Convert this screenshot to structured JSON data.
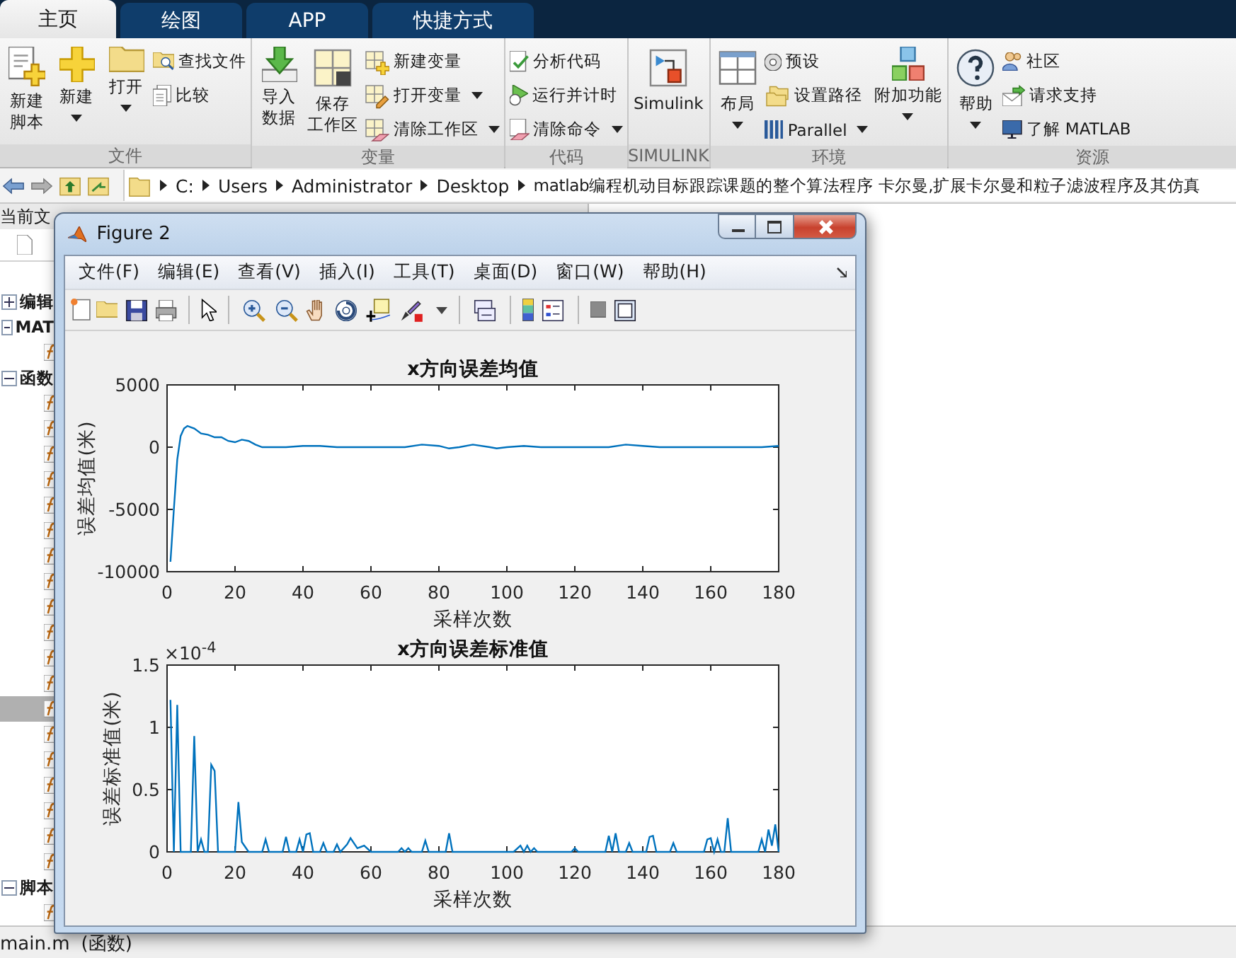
{
  "tabs": [
    {
      "label": "主页",
      "selected": true
    },
    {
      "label": "绘图",
      "selected": false
    },
    {
      "label": "APP",
      "selected": false
    },
    {
      "label": "快捷方式",
      "selected": false
    }
  ],
  "ribbon": [
    {
      "label": "文件",
      "items": [
        {
          "kind": "large",
          "lines": [
            "新建",
            "脚本"
          ],
          "dropdown": false
        },
        {
          "kind": "large",
          "lines": [
            "新建"
          ],
          "dropdown": true
        },
        {
          "kind": "large",
          "lines": [
            "打开"
          ],
          "dropdown": true
        },
        {
          "kind": "column",
          "items": [
            {
              "label": "查找文件",
              "dropdown": false
            },
            {
              "label": "比较",
              "dropdown": false
            }
          ]
        }
      ]
    },
    {
      "label": "变量",
      "items": [
        {
          "kind": "large",
          "lines": [
            "导入",
            "数据"
          ],
          "dropdown": false
        },
        {
          "kind": "large",
          "lines": [
            "保存",
            "工作区"
          ],
          "dropdown": false
        },
        {
          "kind": "column",
          "items": [
            {
              "label": "新建变量",
              "dropdown": false
            },
            {
              "label": "打开变量",
              "dropdown": true
            },
            {
              "label": "清除工作区",
              "dropdown": true
            }
          ]
        }
      ]
    },
    {
      "label": "代码",
      "items": [
        {
          "kind": "column",
          "items": [
            {
              "label": "分析代码",
              "dropdown": false
            },
            {
              "label": "运行并计时",
              "dropdown": false
            },
            {
              "label": "清除命令",
              "dropdown": true
            }
          ]
        }
      ]
    },
    {
      "label": "SIMULINK",
      "items": [
        {
          "kind": "large",
          "lines": [
            "Simulink"
          ],
          "dropdown": false
        }
      ]
    },
    {
      "label": "环境",
      "items": [
        {
          "kind": "large",
          "lines": [
            "布局"
          ],
          "dropdown": true
        },
        {
          "kind": "column",
          "items": [
            {
              "label": "预设",
              "dropdown": false
            },
            {
              "label": "设置路径",
              "dropdown": false
            },
            {
              "label": "Parallel",
              "dropdown": true
            }
          ]
        },
        {
          "kind": "large",
          "lines": [
            "附加功能"
          ],
          "dropdown": true
        }
      ]
    },
    {
      "label": "资源",
      "items": [
        {
          "kind": "large",
          "lines": [
            "帮助"
          ],
          "dropdown": true
        },
        {
          "kind": "column",
          "items": [
            {
              "label": "社区",
              "dropdown": false
            },
            {
              "label": "请求支持",
              "dropdown": false
            },
            {
              "label": "了解 MATLAB",
              "dropdown": false
            }
          ]
        }
      ]
    }
  ],
  "address": {
    "segments": [
      "C:",
      "Users",
      "Administrator",
      "Desktop",
      "matlab编程机动目标跟踪课题的整个算法程序 卡尔曼,扩展卡尔曼和粒子滤波程序及其仿真"
    ]
  },
  "left_panel": {
    "title": "当前文",
    "tree": [
      {
        "label": "编辑",
        "expanded": false
      },
      {
        "label": "MAT",
        "expanded": true,
        "children": [
          {
            "selected": false
          }
        ]
      },
      {
        "label": "函数",
        "expanded": true,
        "children": [
          {
            "selected": false
          },
          {
            "selected": false
          },
          {
            "selected": false
          },
          {
            "selected": false
          },
          {
            "selected": false
          },
          {
            "selected": false
          },
          {
            "selected": false
          },
          {
            "selected": false
          },
          {
            "selected": false
          },
          {
            "selected": false
          },
          {
            "selected": false
          },
          {
            "selected": false
          },
          {
            "selected": true
          },
          {
            "selected": false
          },
          {
            "selected": false
          },
          {
            "selected": false
          },
          {
            "selected": false
          },
          {
            "selected": false
          },
          {
            "selected": false
          }
        ]
      },
      {
        "label": "脚本",
        "expanded": true,
        "children": [
          {
            "selected": false
          }
        ]
      }
    ]
  },
  "status_bar": [
    "main.m",
    "(函数)"
  ],
  "figure": {
    "title": "Figure 2",
    "menu": [
      "文件(F)",
      "编辑(E)",
      "查看(V)",
      "插入(I)",
      "工具(T)",
      "桌面(D)",
      "窗口(W)",
      "帮助(H)"
    ],
    "charts": [
      {
        "chart_data": {
          "type": "line",
          "title": "x方向误差均值",
          "xlabel": "采样次数",
          "ylabel": "误差均值(米)",
          "xlim": [
            0,
            180
          ],
          "ylim": [
            -10000,
            5000
          ],
          "xticks": [
            0,
            20,
            40,
            60,
            80,
            100,
            120,
            140,
            160,
            180
          ],
          "yticks": [
            -10000,
            -5000,
            0,
            5000
          ],
          "x": [
            1,
            2,
            3,
            4,
            5,
            6,
            7,
            8,
            10,
            12,
            14,
            16,
            18,
            20,
            22,
            24,
            26,
            28,
            30,
            35,
            40,
            45,
            50,
            55,
            60,
            65,
            70,
            75,
            80,
            83,
            86,
            90,
            95,
            97,
            100,
            105,
            110,
            115,
            120,
            125,
            130,
            135,
            140,
            145,
            150,
            155,
            160,
            165,
            170,
            175,
            180
          ],
          "series": [
            {
              "color": "#0072bd",
              "values": [
                -9200,
                -5000,
                -1000,
                900,
                1500,
                1700,
                1600,
                1500,
                1100,
                1000,
                800,
                800,
                500,
                400,
                600,
                500,
                200,
                0,
                0,
                0,
                100,
                100,
                0,
                0,
                0,
                0,
                0,
                200,
                100,
                -100,
                0,
                200,
                0,
                -100,
                0,
                100,
                0,
                0,
                0,
                0,
                0,
                200,
                100,
                0,
                0,
                0,
                0,
                0,
                0,
                0,
                100
              ]
            }
          ]
        }
      },
      {
        "chart_data": {
          "type": "line",
          "title": "x方向误差标准值",
          "xlabel": "采样次数",
          "ylabel": "误差标准值(米)",
          "xlim": [
            0,
            180
          ],
          "ylim": [
            0,
            1.5
          ],
          "xticks": [
            0,
            20,
            40,
            60,
            80,
            100,
            120,
            140,
            160,
            180
          ],
          "yticks": [
            0,
            0.5,
            1,
            1.5
          ],
          "annotations": [
            {
              "text": "×10$^{-4}$"
            }
          ],
          "x": [
            1,
            2,
            3,
            4,
            7,
            8,
            9,
            10,
            11,
            12,
            13,
            14,
            15,
            20,
            21,
            22,
            24,
            28,
            29,
            30,
            34,
            35,
            36,
            38,
            39,
            40,
            41,
            42,
            43,
            45,
            46,
            47,
            49,
            50,
            51,
            53,
            54,
            56,
            58,
            60,
            68,
            69,
            70,
            71,
            72,
            75,
            76,
            77,
            82,
            83,
            84,
            102,
            104,
            105,
            106,
            107,
            108,
            109,
            119,
            120,
            121,
            129,
            130,
            131,
            132,
            133,
            135,
            136,
            137,
            141,
            142,
            143,
            144,
            148,
            149,
            150,
            158,
            159,
            160,
            161,
            162,
            163,
            164,
            165,
            166,
            174,
            175,
            176,
            177,
            178,
            179,
            180
          ],
          "series": [
            {
              "color": "#0072bd",
              "values": [
                1.22,
                0,
                1.18,
                0,
                0,
                0.93,
                0,
                0.1,
                0,
                0,
                0.7,
                0.65,
                0,
                0,
                0.4,
                0.08,
                0,
                0,
                0.1,
                0,
                0,
                0.12,
                0,
                0,
                0.1,
                0,
                0.14,
                0.15,
                0,
                0,
                0.07,
                0,
                0,
                0.06,
                0,
                0.06,
                0.11,
                0.03,
                0.05,
                0,
                0,
                0.03,
                0,
                0.03,
                0,
                0,
                0.09,
                0,
                0,
                0.15,
                0,
                0,
                0.05,
                0,
                0.05,
                0,
                0.03,
                0,
                0,
                0.03,
                0,
                0,
                0.13,
                0,
                0.15,
                0,
                0,
                0.07,
                0,
                0,
                0.12,
                0.13,
                0,
                0,
                0.07,
                0,
                0,
                0.1,
                0.11,
                0,
                0.1,
                0,
                0,
                0.27,
                0,
                0,
                0.1,
                0,
                0.18,
                0.05,
                0.22,
                0
              ]
            }
          ]
        }
      }
    ]
  }
}
